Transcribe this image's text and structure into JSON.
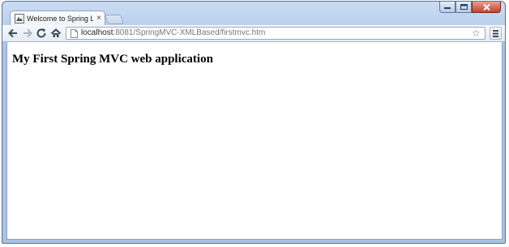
{
  "tab": {
    "title": "Welcome to Spring Learni",
    "close_glyph": "×"
  },
  "window_controls": [
    "minimize",
    "maximize",
    "close"
  ],
  "toolbar": {
    "icons": [
      "back-icon",
      "forward-icon",
      "reload-icon",
      "home-icon",
      "page-icon",
      "star-icon",
      "menu-icon"
    ]
  },
  "address_bar": {
    "host": "localhost",
    "path": ":8081/SpringMVC-XMLBased/firstmvc.htm"
  },
  "page": {
    "heading": "My First Spring MVC web application"
  },
  "colors": {
    "frame": "#b7cde9",
    "close_button": "#c4432b",
    "content_background": "#ffffff"
  }
}
